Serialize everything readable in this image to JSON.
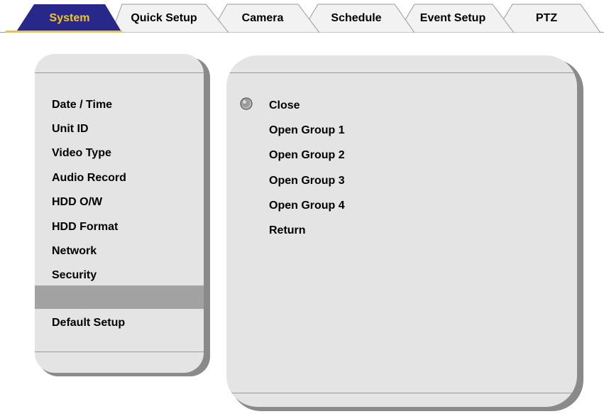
{
  "tabs": [
    {
      "label": "System",
      "active": true
    },
    {
      "label": "Quick Setup"
    },
    {
      "label": "Camera"
    },
    {
      "label": "Schedule"
    },
    {
      "label": "Event Setup"
    },
    {
      "label": "PTZ"
    }
  ],
  "left_menu": {
    "items": [
      "Date / Time",
      "Unit ID",
      "Video Type",
      "Audio Record",
      "HDD O/W",
      "HDD Format",
      "Network",
      "Security",
      "",
      "Default Setup"
    ]
  },
  "right_panel": {
    "options": [
      "Close",
      "Open Group 1",
      "Open Group 2",
      "Open Group 3",
      "Open Group 4",
      "Return"
    ],
    "selected_option": "Close"
  },
  "colors": {
    "active_tab": "#28278a",
    "active_tab_accent": "#f3c51e",
    "inactive_tab": "#f2f2f2",
    "panel_bg": "#e4e4e4",
    "panel_shadow": "#8a8a8a",
    "selected_row": "#a2a2a2"
  }
}
